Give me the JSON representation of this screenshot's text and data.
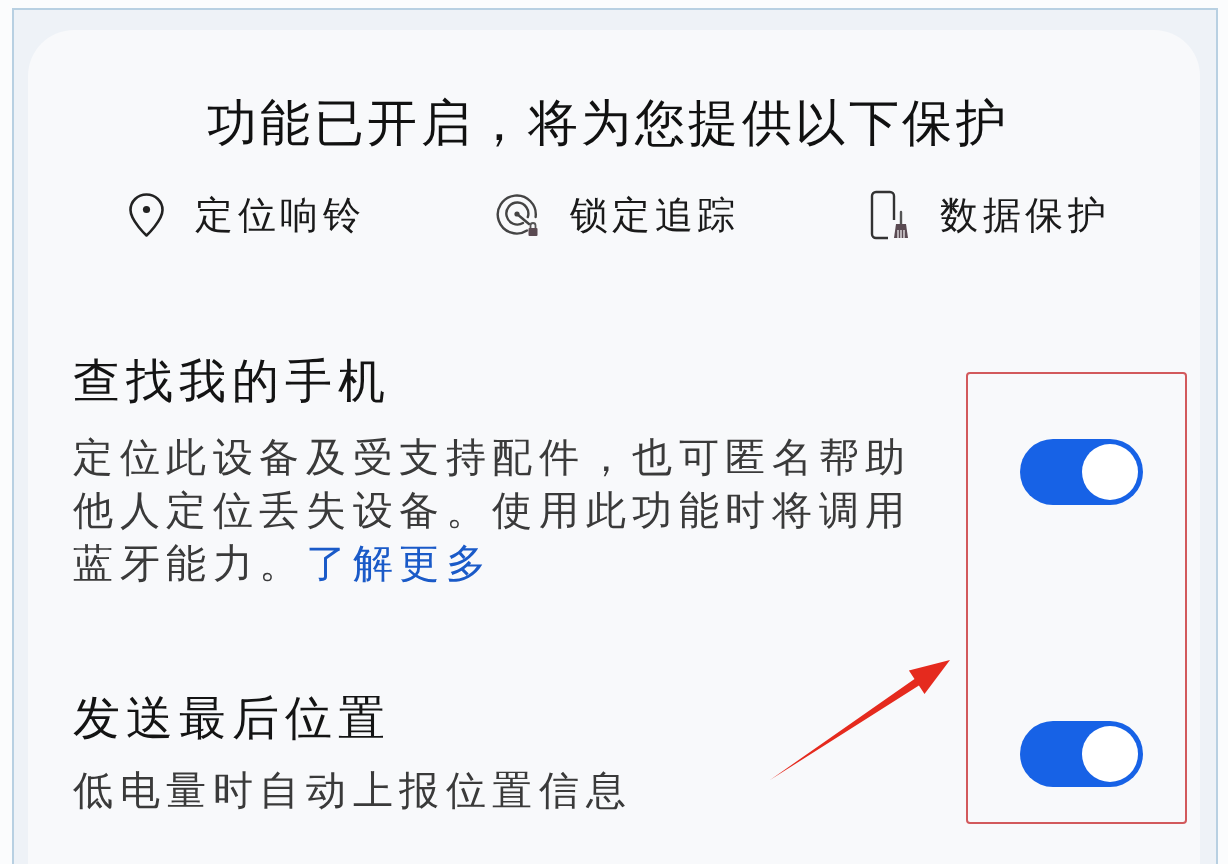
{
  "header": {
    "title": "功能已开启，将为您提供以下保护"
  },
  "features": [
    {
      "kind": "locate",
      "label": "定位响铃"
    },
    {
      "kind": "track",
      "label": "锁定追踪"
    },
    {
      "kind": "protect",
      "label": "数据保护"
    }
  ],
  "settings": [
    {
      "title": "查找我的手机",
      "description": "定位此设备及受支持配件，也可匿名帮助他人定位丢失设备。使用此功能时将调用蓝牙能力。",
      "link": "了解更多",
      "on": true
    },
    {
      "title": "发送最后位置",
      "description": "低电量时自动上报位置信息",
      "on": true
    }
  ]
}
